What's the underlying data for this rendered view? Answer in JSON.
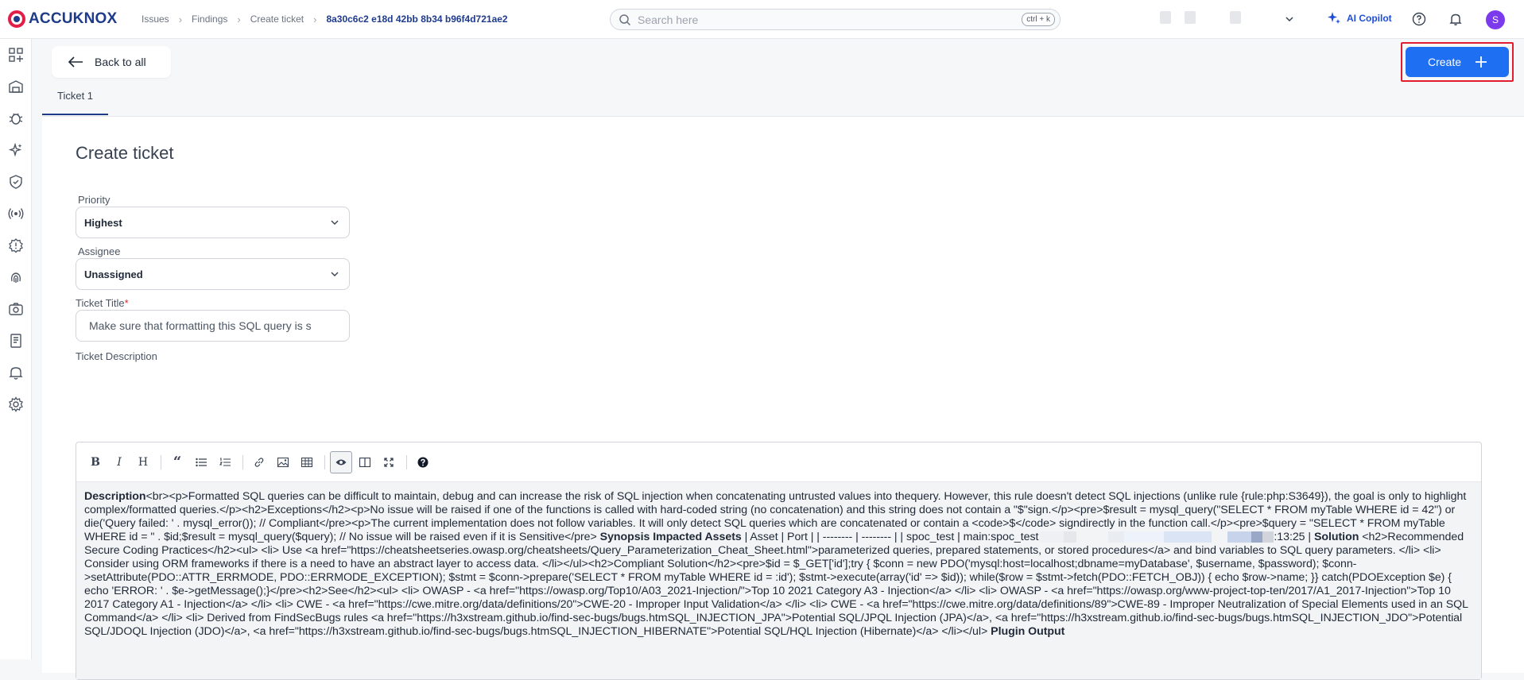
{
  "brand": {
    "logo_text": "ACCUKNOX"
  },
  "breadcrumb": {
    "items": [
      "Issues",
      "Findings",
      "Create ticket"
    ],
    "current": "8a30c6c2 e18d 42bb 8b34 b96f4d721ae2"
  },
  "search": {
    "placeholder": "Search here",
    "shortcut": "ctrl + k"
  },
  "header": {
    "copilot_label": "AI Copilot",
    "avatar_initial": "S"
  },
  "actions": {
    "back_label": "Back to all",
    "create_label": "Create"
  },
  "tabs": [
    {
      "label": "Ticket 1"
    }
  ],
  "form": {
    "title": "Create ticket",
    "priority": {
      "label": "Priority",
      "value": "Highest"
    },
    "assignee": {
      "label": "Assignee",
      "value": "Unassigned"
    },
    "ticket_title": {
      "label": "Ticket Title",
      "required_mark": "*",
      "value": "Make sure that formatting this SQL query is s"
    },
    "description": {
      "label": "Ticket Description",
      "toolbar": [
        "bold",
        "italic",
        "heading",
        "quote",
        "unordered-list",
        "ordered-list",
        "link",
        "image",
        "table",
        "preview",
        "side-by-side",
        "fullscreen",
        "guide"
      ],
      "bold_description": "Description",
      "part1": "<br><p>Formatted SQL queries can be difficult to maintain, debug and can increase the risk of SQL injection when concatenating untrusted values into thequery. However, this rule doesn't detect SQL injections (unlike rule {rule:php:S3649}), the goal is only to highlight complex/formatted queries.</p><h2>Exceptions</h2><p>No issue will be raised if one of the functions is called with hard-coded string (no concatenation) and this string does not contain a \"$\"sign.</p><pre>$result = mysql_query(\"SELECT * FROM myTable WHERE id = 42\") or die('Query failed: ' . mysql_error()); // Compliant</pre><p>The current implementation does not follow variables. It will only detect SQL queries which are concatenated or contain a <code>$</code> signdirectly in the function call.</p><pre>$query = \"SELECT * FROM myTable WHERE id = \" . $id;$result = mysql_query($query); // No issue will be raised even if it is Sensitive</pre>",
      "bold_synopsis": "Synopsis Impacted Assets",
      "part2": "| Asset | Port | | -------- | -------- | | spoc_test | main:spoc_test",
      "part3": ":13:25 |",
      "bold_solution": "Solution",
      "part4": "<h2>Recommended Secure Coding Practices</h2><ul> <li> Use <a href=\"https://cheatsheetseries.owasp.org/cheatsheets/Query_Parameterization_Cheat_Sheet.html\">parameterized queries, prepared statements, or stored procedures</a> and bind variables to SQL query parameters. </li> <li> Consider using ORM frameworks if there is a need to have an abstract layer to access data. </li></ul><h2>Compliant Solution</h2><pre>$id = $_GET['id'];try { $conn = new PDO('mysql:host=localhost;dbname=myDatabase', $username, $password); $conn->setAttribute(PDO::ATTR_ERRMODE, PDO::ERRMODE_EXCEPTION); $stmt = $conn->prepare('SELECT * FROM myTable WHERE id = :id'); $stmt->execute(array('id' => $id)); while($row = $stmt->fetch(PDO::FETCH_OBJ)) { echo $row->name; }} catch(PDOException $e) { echo 'ERROR: ' . $e->getMessage();}</pre><h2>See</h2><ul> <li> OWASP - <a href=\"https://owasp.org/Top10/A03_2021-Injection/\">Top 10 2021 Category A3 - Injection</a> </li> <li> OWASP - <a href=\"https://owasp.org/www-project-top-ten/2017/A1_2017-Injection\">Top 10 2017 Category A1 - Injection</a> </li> <li> CWE - <a href=\"https://cwe.mitre.org/data/definitions/20\">CWE-20 - Improper Input Validation</a> </li> <li> CWE - <a href=\"https://cwe.mitre.org/data/definitions/89\">CWE-89 - Improper Neutralization of Special Elements used in an SQL Command</a> </li> <li> Derived from FindSecBugs rules <a href=\"https://h3xstream.github.io/find-sec-bugs/bugs.htmSQL_INJECTION_JPA\">Potential SQL/JPQL Injection (JPA)</a>, <a href=\"https://h3xstream.github.io/find-sec-bugs/bugs.htmSQL_INJECTION_JDO\">Potential SQL/JDOQL Injection (JDO)</a>, <a href=\"https://h3xstream.github.io/find-sec-bugs/bugs.htmSQL_INJECTION_HIBERNATE\">Potential SQL/HQL Injection (Hibernate)</a> </li></ul>",
      "bold_plugin": "Plugin Output"
    }
  },
  "colors": {
    "primary": "#1f6ff2",
    "brand_navy": "#1e3a8a",
    "highlight_border": "#e11d2f",
    "avatar": "#7c3aed"
  }
}
